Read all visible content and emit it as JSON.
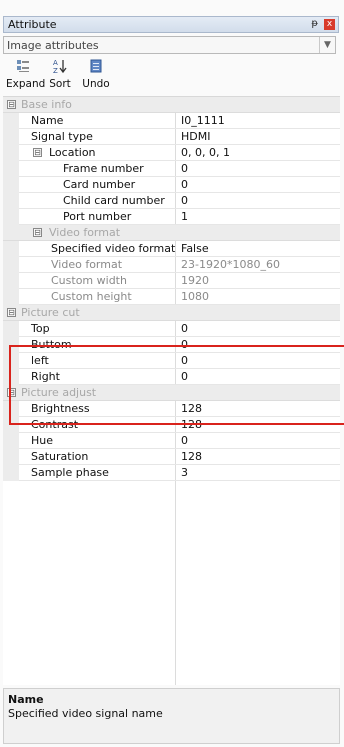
{
  "window": {
    "title": "Attribute",
    "pin_glyph": "ᵽ",
    "close_glyph": "x"
  },
  "selector": {
    "value": "Image attributes"
  },
  "toolbar": {
    "expand_label": "Expand",
    "sort_label": "Sort",
    "undo_label": "Undo"
  },
  "grid": {
    "base_info": {
      "category": "Base info",
      "name": {
        "label": "Name",
        "value": "I0_1111"
      },
      "signal_type": {
        "label": "Signal type",
        "value": "HDMI"
      },
      "location": {
        "label": "Location",
        "value": "0, 0, 0, 1"
      },
      "frame_number": {
        "label": "Frame number",
        "value": "0"
      },
      "card_number": {
        "label": "Card number",
        "value": "0"
      },
      "child_card_number": {
        "label": "Child card number",
        "value": "0"
      },
      "port_number": {
        "label": "Port number",
        "value": "1"
      }
    },
    "video_format": {
      "category": "Video format",
      "specified": {
        "label": "Specified video format",
        "value": "False"
      },
      "format": {
        "label": "Video format",
        "value": "23-1920*1080_60"
      },
      "custom_width": {
        "label": "Custom width",
        "value": "1920"
      },
      "custom_height": {
        "label": "Custom height",
        "value": "1080"
      }
    },
    "picture_cut": {
      "category": "Picture cut",
      "top": {
        "label": "Top",
        "value": "0"
      },
      "buttom": {
        "label": "Buttom",
        "value": "0"
      },
      "left": {
        "label": "left",
        "value": "0"
      },
      "right": {
        "label": "Right",
        "value": "0"
      }
    },
    "picture_adjust": {
      "category": "Picture adjust",
      "brightness": {
        "label": "Brightness",
        "value": "128"
      },
      "contrast": {
        "label": "Contrast",
        "value": "128"
      },
      "hue": {
        "label": "Hue",
        "value": "0"
      },
      "saturation": {
        "label": "Saturation",
        "value": "128"
      },
      "sample_phase": {
        "label": "Sample phase",
        "value": "3"
      }
    },
    "expander_glyph": "⊟"
  },
  "description": {
    "title": "Name",
    "text": "Specified video signal name"
  },
  "colors": {
    "highlight": "#d9231c",
    "category_text": "#a8a8a8",
    "disabled_text": "#8a8a8a"
  },
  "icons": [
    "expand-icon",
    "sort-icon",
    "undo-icon",
    "pin-icon",
    "close-icon",
    "dropdown-arrow-icon",
    "collapse-toggle-icon"
  ]
}
